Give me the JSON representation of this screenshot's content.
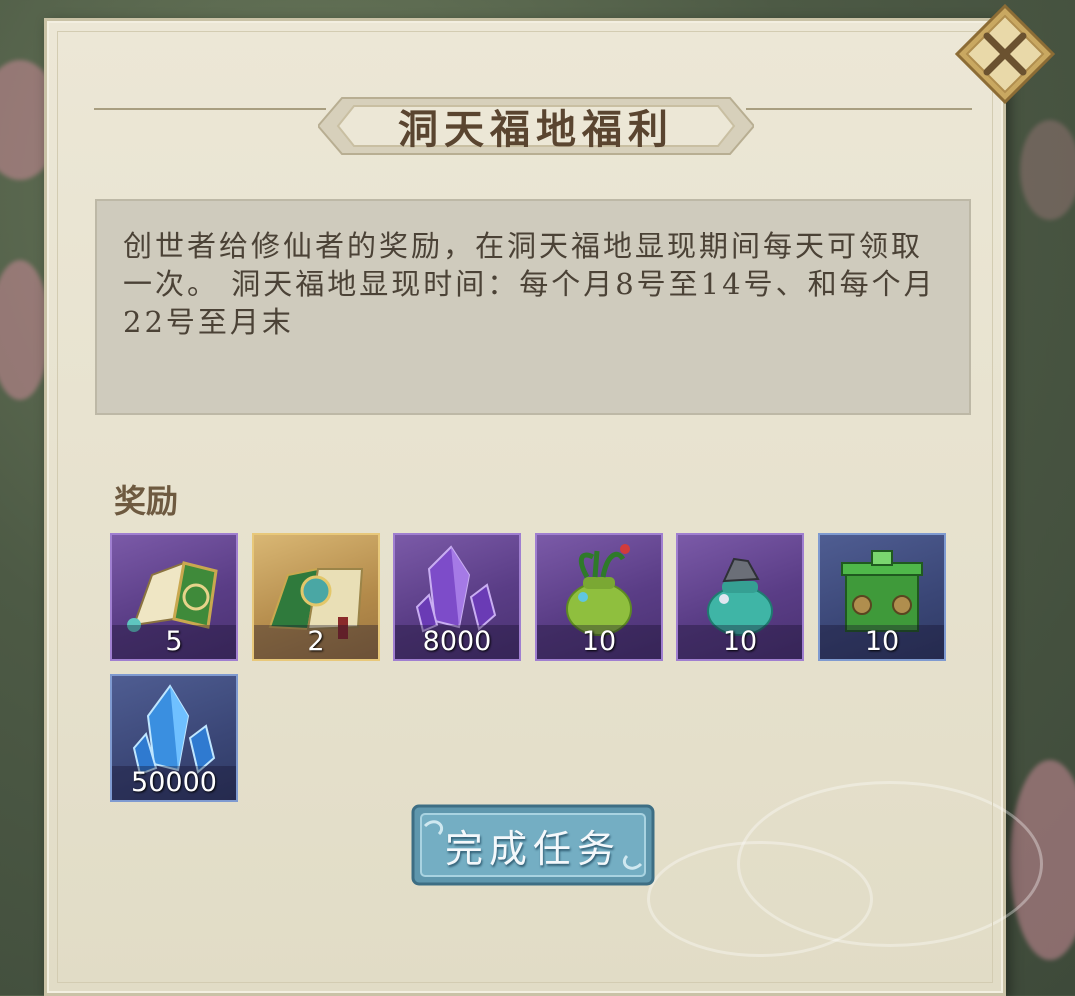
{
  "dialog": {
    "title": "洞天福地福利",
    "description": "创世者给修仙者的奖励，在洞天福地显现期间每天可领取一次。 洞天福地显现时间：每个月8号至14号、和每个月22号至月末",
    "rewards_label": "奖励",
    "complete_button": "完成任务",
    "close_icon": "close-icon"
  },
  "rewards": [
    {
      "name": "book-item",
      "icon": "scroll-book-icon",
      "count": "5",
      "rarity": "purple"
    },
    {
      "name": "map-scroll-item",
      "icon": "map-scroll-icon",
      "count": "2",
      "rarity": "gold"
    },
    {
      "name": "purple-crystal-item",
      "icon": "purple-crystal-icon",
      "count": "8000",
      "rarity": "purple"
    },
    {
      "name": "herb-pouch-item",
      "icon": "herb-pouch-icon",
      "count": "10",
      "rarity": "purple"
    },
    {
      "name": "ore-pouch-item",
      "icon": "ore-pouch-icon",
      "count": "10",
      "rarity": "purple"
    },
    {
      "name": "jade-chest-item",
      "icon": "jade-chest-icon",
      "count": "10",
      "rarity": "blue"
    },
    {
      "name": "blue-crystal-item",
      "icon": "blue-crystal-icon",
      "count": "50000",
      "rarity": "blue"
    }
  ],
  "colors": {
    "panel": "#e6e1cd",
    "title_text": "#5a4530",
    "purple_frame": "#5a3d86",
    "gold_frame": "#b38a4a",
    "blue_frame": "#3a4676",
    "button": "#6fa7bd"
  }
}
